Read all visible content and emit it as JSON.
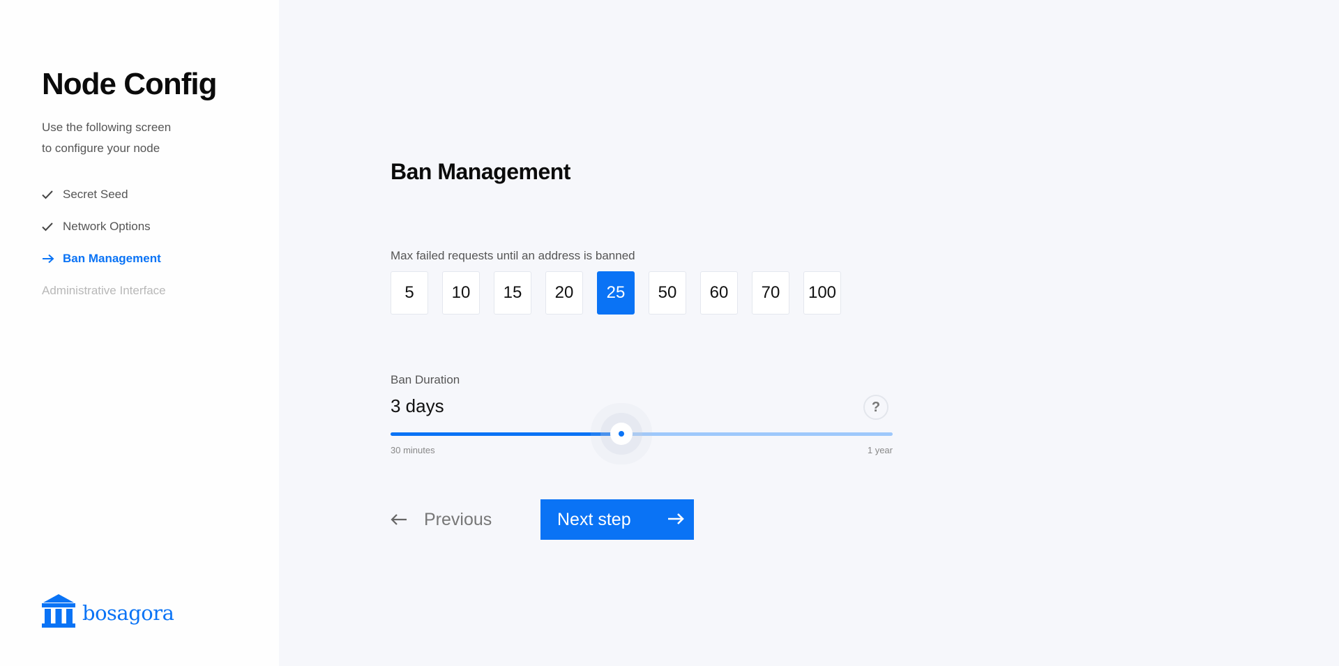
{
  "sidebar": {
    "title": "Node Config",
    "subtitle_line1": "Use the following screen",
    "subtitle_line2": "to configure your node",
    "steps": [
      {
        "label": "Secret Seed",
        "state": "done",
        "icon": "check-icon"
      },
      {
        "label": "Network Options",
        "state": "done",
        "icon": "check-icon"
      },
      {
        "label": "Ban Management",
        "state": "active",
        "icon": "arrow-right-icon"
      },
      {
        "label": "Administrative Interface",
        "state": "future",
        "icon": ""
      }
    ],
    "logo_text": "bosagora"
  },
  "main": {
    "title": "Ban Management",
    "max_failed": {
      "label": "Max failed requests until an address is banned",
      "options": [
        "5",
        "10",
        "15",
        "20",
        "25",
        "50",
        "60",
        "70",
        "100"
      ],
      "selected": "25"
    },
    "ban_duration": {
      "label": "Ban Duration",
      "value": "3 days",
      "min_label": "30 minutes",
      "max_label": "1 year",
      "slider_fraction": 0.46,
      "help_glyph": "?"
    },
    "previous_label": "Previous",
    "next_label": "Next step"
  },
  "colors": {
    "accent": "#0a73f5",
    "track_light": "#9ec8fb",
    "background": "#f6f7fb",
    "sidebar": "#fefefe"
  }
}
